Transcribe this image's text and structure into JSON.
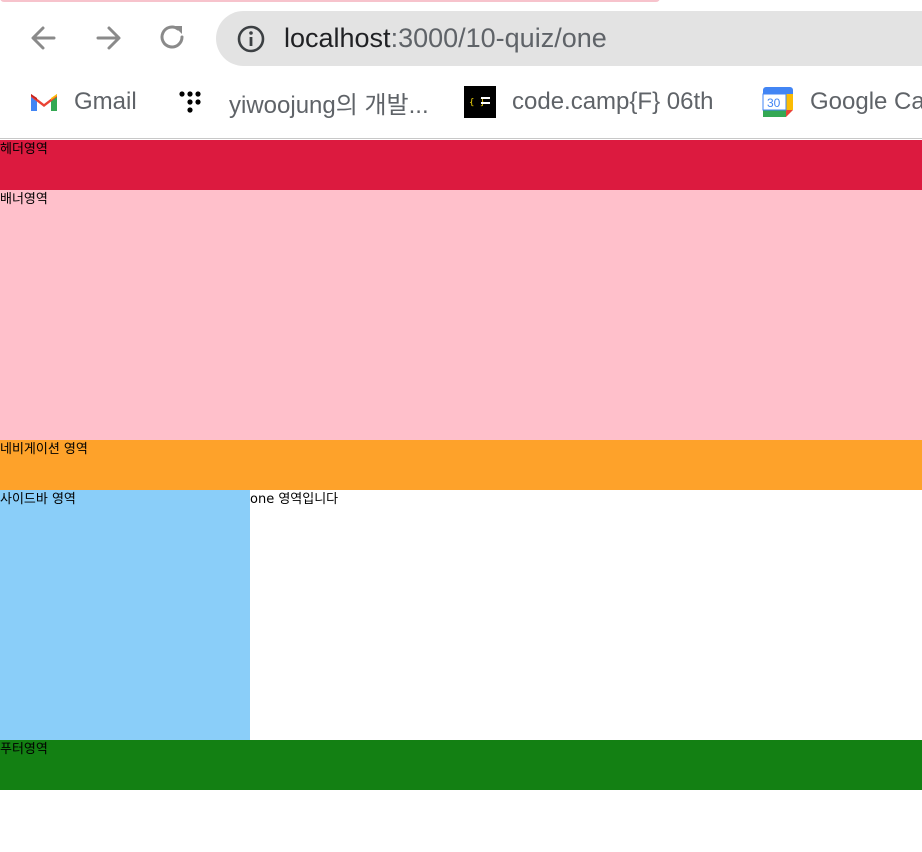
{
  "browser": {
    "url_host": "localhost",
    "url_path": ":3000/10-quiz/one",
    "bookmarks": [
      {
        "label": "Gmail",
        "icon": "gmail-icon"
      },
      {
        "label": "yiwoojung의 개발...",
        "icon": "dots-icon"
      },
      {
        "label": "code.camp{F} 06th",
        "icon": "codecamp-icon"
      },
      {
        "label": "Google Ca",
        "icon": "google-calendar-icon"
      }
    ],
    "calendar_icon_number": "30"
  },
  "layout": {
    "header": {
      "label": "헤더영역",
      "color": "#dc1a3f"
    },
    "banner": {
      "label": "배너영역",
      "color": "#ffc0cb"
    },
    "navigation": {
      "label": "네비게이션 영역",
      "color": "#fea22a"
    },
    "sidebar": {
      "label": "사이드바 영역",
      "color": "#8acef9"
    },
    "main": {
      "label": "one 영역입니다",
      "color": "#ffffff"
    },
    "footer": {
      "label": "푸터영역",
      "color": "#138013"
    }
  }
}
